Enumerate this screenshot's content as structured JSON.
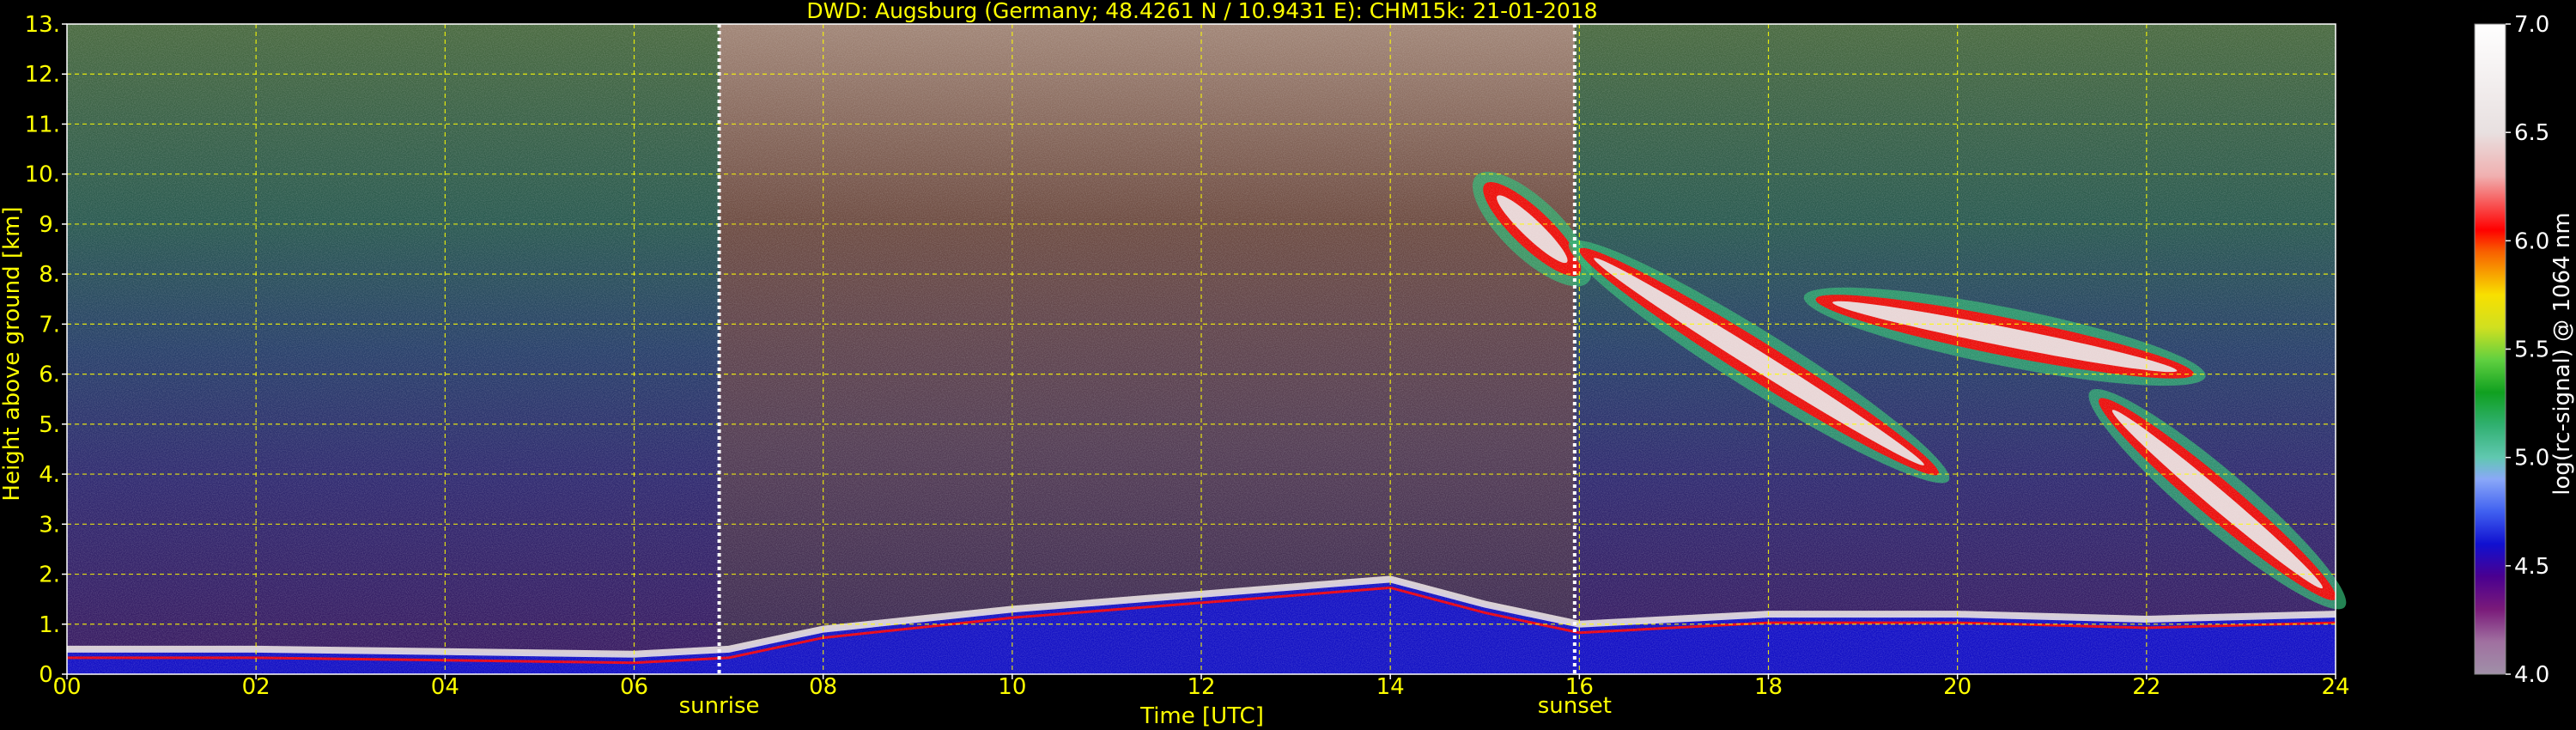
{
  "colors": {
    "background": "#000000",
    "axis_text": "#ffff00",
    "colorbar_text": "#ffffff",
    "grid": "#ffff00",
    "marker_line": "#ffffff",
    "frame": "#ffffff"
  },
  "chart_data": {
    "type": "heatmap",
    "title": "DWD: Augsburg (Germany; 48.4261 N / 10.9431 E):    CHM15k: 21-01-2018",
    "xlabel": "Time [UTC]",
    "ylabel": "Height above ground [km]",
    "xlim": [
      0,
      24
    ],
    "ylim": [
      0,
      13
    ],
    "x_ticks": [
      0,
      2,
      4,
      6,
      8,
      10,
      12,
      14,
      16,
      18,
      20,
      22,
      24
    ],
    "x_tick_labels": [
      "00",
      "02",
      "04",
      "06",
      "08",
      "10",
      "12",
      "14",
      "16",
      "18",
      "20",
      "22",
      "24"
    ],
    "y_ticks": [
      0,
      1,
      2,
      3,
      4,
      5,
      6,
      7,
      8,
      9,
      10,
      11,
      12,
      13
    ],
    "y_tick_labels": [
      "0.",
      "1.",
      "2.",
      "3.",
      "4.",
      "5.",
      "6.",
      "7.",
      "8.",
      "9.",
      "10.",
      "11.",
      "12.",
      "13."
    ],
    "grid": true,
    "markers": [
      {
        "label": "sunrise",
        "x": 6.9
      },
      {
        "label": "sunset",
        "x": 15.95
      }
    ],
    "colorbar": {
      "label": "log(rc-signal) @ 1064 nm",
      "min": 4.0,
      "max": 7.0,
      "ticks": [
        4.0,
        4.5,
        5.0,
        5.5,
        6.0,
        6.5,
        7.0
      ],
      "tick_labels": [
        "4.0",
        "4.5",
        "5.0",
        "5.5",
        "6.0",
        "6.5",
        "7.0"
      ],
      "stops": [
        {
          "v": 4.0,
          "c": "#a090a8"
        },
        {
          "v": 4.15,
          "c": "#a070a0"
        },
        {
          "v": 4.3,
          "c": "#7a1a7a"
        },
        {
          "v": 4.45,
          "c": "#4a0090"
        },
        {
          "v": 4.6,
          "c": "#1010d0"
        },
        {
          "v": 4.75,
          "c": "#4060f0"
        },
        {
          "v": 4.9,
          "c": "#8aa8f8"
        },
        {
          "v": 5.0,
          "c": "#60c8b0"
        },
        {
          "v": 5.15,
          "c": "#30b070"
        },
        {
          "v": 5.3,
          "c": "#10a020"
        },
        {
          "v": 5.45,
          "c": "#60d040"
        },
        {
          "v": 5.6,
          "c": "#d0e020"
        },
        {
          "v": 5.75,
          "c": "#f8e000"
        },
        {
          "v": 5.85,
          "c": "#f8a000"
        },
        {
          "v": 5.95,
          "c": "#f86000"
        },
        {
          "v": 6.05,
          "c": "#ff0000"
        },
        {
          "v": 6.3,
          "c": "#f0b0b0"
        },
        {
          "v": 6.5,
          "c": "#e8e0e0"
        },
        {
          "v": 7.0,
          "c": "#ffffff"
        }
      ]
    },
    "features": [
      {
        "kind": "boundary_layer",
        "x": [
          0,
          2,
          4,
          6,
          7,
          8,
          10,
          12,
          14,
          15,
          16,
          18,
          20,
          22,
          24
        ],
        "top": [
          0.5,
          0.5,
          0.45,
          0.4,
          0.5,
          0.9,
          1.3,
          1.6,
          1.9,
          1.4,
          1.0,
          1.2,
          1.2,
          1.1,
          1.2
        ]
      },
      {
        "kind": "cloud",
        "x0": 15.0,
        "y0": 9.8,
        "x1": 16.0,
        "y1": 8.0
      },
      {
        "kind": "cloud",
        "x0": 16.0,
        "y0": 8.5,
        "x1": 19.8,
        "y1": 4.0
      },
      {
        "kind": "cloud",
        "x0": 18.5,
        "y0": 7.5,
        "x1": 22.5,
        "y1": 6.0
      },
      {
        "kind": "cloud",
        "x0": 21.5,
        "y0": 5.5,
        "x1": 24.0,
        "y1": 1.5
      }
    ]
  }
}
